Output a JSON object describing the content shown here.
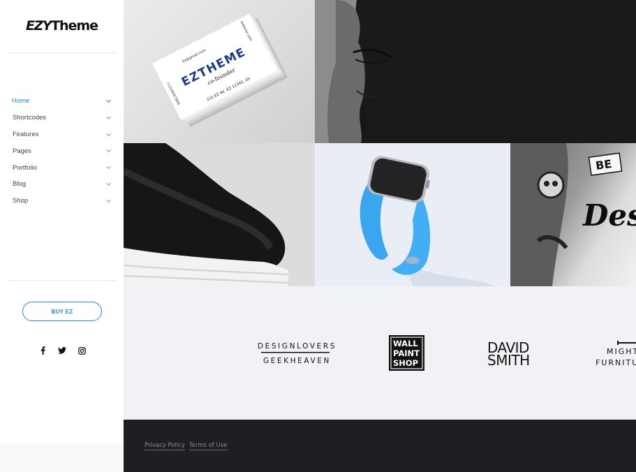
{
  "logo": {
    "part1": "EZY",
    "part2": "Theme"
  },
  "nav": {
    "items": [
      {
        "label": "Home",
        "active": true
      },
      {
        "label": "Shortcodes"
      },
      {
        "label": "Features"
      },
      {
        "label": "Pages"
      },
      {
        "label": "Portfolio"
      },
      {
        "label": "Blog"
      },
      {
        "label": "Shop"
      }
    ]
  },
  "buy_button": {
    "label": "BUY EZ"
  },
  "social": [
    {
      "icon": "facebook-icon"
    },
    {
      "icon": "twitter-icon"
    },
    {
      "icon": "instagram-icon"
    }
  ],
  "gallery": {
    "business_card": {
      "brand": "EZTHEME",
      "role": "co-founder",
      "email": "Ez@gmail.com",
      "web": "www.ez.com",
      "address": "315 EZ AV, EZ 12345, US",
      "phone": "+1234567844"
    },
    "tattoo_text_top": "BE",
    "tattoo_text_script": "Des"
  },
  "clients": {
    "logo1_top": "DESIGNLOVERS",
    "logo1_bottom": "GEEKHEAVEN",
    "logo2_lines": [
      "WALL",
      "PAINT",
      "SHOP"
    ],
    "logo3_lines": [
      "DAVID",
      "SMITH"
    ],
    "logo4_lines": [
      "MIGHT",
      "FURNITU"
    ]
  },
  "footer": {
    "links": [
      "Privacy Policy",
      "Terms of Use"
    ]
  },
  "colors": {
    "accent": "#1e88e5",
    "footer_bg": "#1d1f22",
    "band_bg": "#f0f2f5"
  }
}
